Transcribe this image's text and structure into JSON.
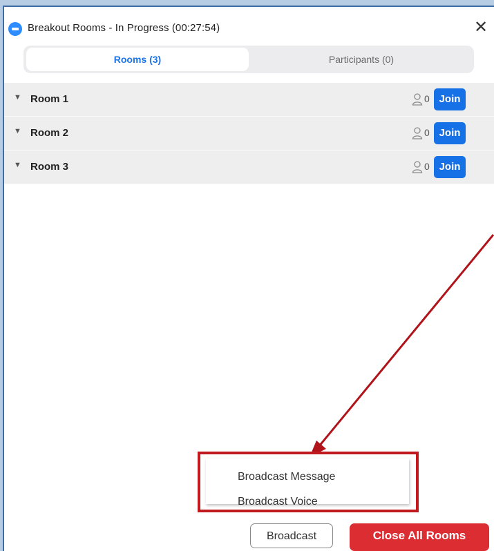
{
  "window": {
    "title": "Breakout Rooms - In Progress (00:27:54)",
    "close_symbol": "✕"
  },
  "tabs": [
    {
      "label": "Rooms (3)",
      "selected": true
    },
    {
      "label": "Participants (0)",
      "selected": false
    }
  ],
  "rooms": [
    {
      "name": "Room 1",
      "count": "0",
      "join_label": "Join"
    },
    {
      "name": "Room 2",
      "count": "0",
      "join_label": "Join"
    },
    {
      "name": "Room 3",
      "count": "0",
      "join_label": "Join"
    }
  ],
  "broadcast_menu": {
    "items": [
      "Broadcast Message",
      "Broadcast Voice"
    ]
  },
  "footer": {
    "broadcast_label": "Broadcast",
    "close_all_label": "Close All Rooms"
  },
  "colors": {
    "accent": "#1670e6",
    "danger": "#dc2d33",
    "annotation": "#c0191e"
  },
  "icons": [
    "zoom-logo-icon",
    "close-icon",
    "chevron-down-icon",
    "person-icon"
  ]
}
